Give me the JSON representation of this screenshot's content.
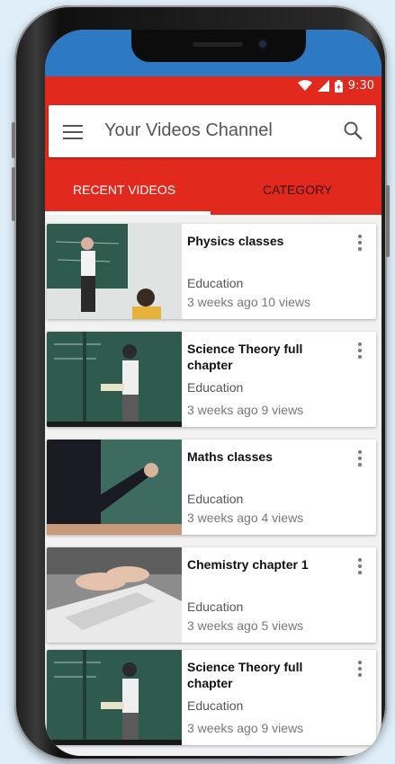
{
  "status_bar": {
    "time": "9:30",
    "icons": [
      "wifi-icon",
      "signal-icon",
      "battery-icon"
    ]
  },
  "app_bar": {
    "title": "Your Videos Channel",
    "menu_icon": "hamburger-menu-icon",
    "search_icon": "search-icon"
  },
  "tabs": [
    {
      "label": "RECENT VIDEOS",
      "selected": true
    },
    {
      "label": "CATEGORY",
      "selected": false
    }
  ],
  "videos": [
    {
      "title": "Physics classes",
      "category": "Education",
      "age": "3 weeks ago",
      "views": "10 views",
      "thumb": "teacher-at-chalkboard"
    },
    {
      "title": "Science Theory full chapter",
      "category": "Education",
      "age": "3 weeks ago",
      "views": "9 views",
      "thumb": "teacher-with-book"
    },
    {
      "title": "Maths classes",
      "category": "Education",
      "age": "3 weeks ago",
      "views": "4 views",
      "thumb": "hand-writing-on-board"
    },
    {
      "title": "Chemistry chapter 1",
      "category": "Education",
      "age": "3 weeks ago",
      "views": "5 views",
      "thumb": "hands-on-laptop"
    },
    {
      "title": "Science Theory full chapter",
      "category": "Education",
      "age": "3 weeks ago",
      "views": "9 views",
      "thumb": "teacher-with-book"
    }
  ],
  "colors": {
    "primary": "#e2291d",
    "tab_indicator": "#ffffff",
    "frame": "#1c1c1c"
  }
}
